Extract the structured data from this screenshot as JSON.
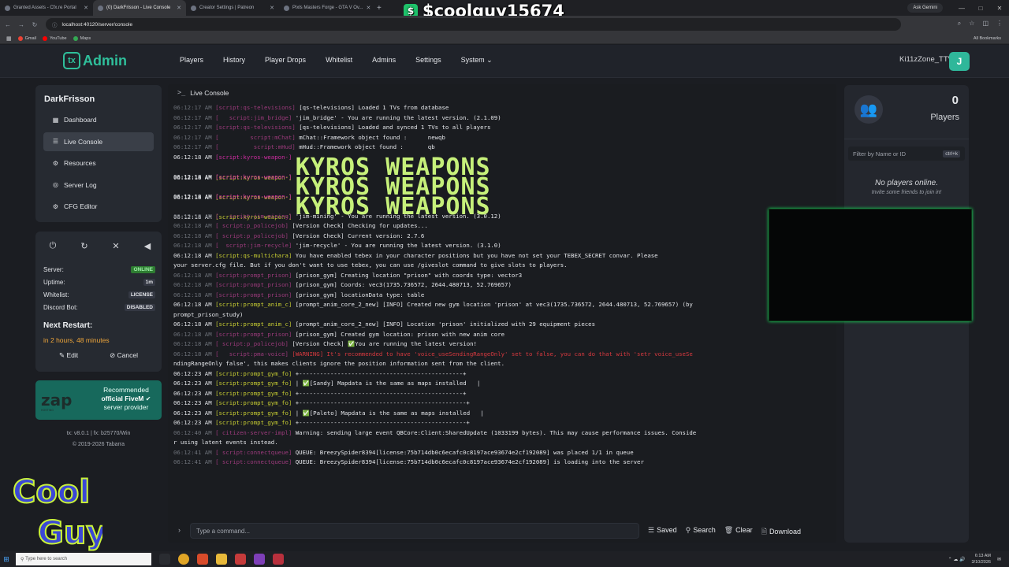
{
  "browser": {
    "tabs": [
      {
        "label": "Granted Assets - Cfx.re Portal",
        "active": false
      },
      {
        "label": "(0) DarkFrisson - Live Console",
        "active": true
      },
      {
        "label": "Creator Settings | Patreon",
        "active": false
      },
      {
        "label": "Pixls Masters Forge - GTA V Ov...",
        "active": false
      }
    ],
    "url": "localhost:40120/server/console",
    "gemini": "Ask Gemini",
    "bookmarks": [
      "Gmail",
      "YouTube",
      "Maps"
    ],
    "all_bookmarks": "All Bookmarks"
  },
  "overlay": {
    "username": "$coolguy15674",
    "coin": "$"
  },
  "app": {
    "logo_tx": "tx",
    "logo_name": "Admin",
    "nav": [
      "Players",
      "History",
      "Player Drops",
      "Whitelist",
      "Admins",
      "Settings",
      "System ⌄"
    ],
    "user_name": "Ki11zZone_TTV",
    "user_initial": "J"
  },
  "sidebar": {
    "server_name": "DarkFrisson",
    "items": [
      {
        "icon": "▦",
        "label": "Dashboard"
      },
      {
        "icon": "☰",
        "label": "Live Console"
      },
      {
        "icon": "⚙",
        "label": "Resources"
      },
      {
        "icon": "◎",
        "label": "Server Log"
      },
      {
        "icon": "⚙",
        "label": "CFG Editor"
      }
    ]
  },
  "status": {
    "controls": [
      "⏻",
      "↻",
      "✕",
      "◀"
    ],
    "server_label": "Server:",
    "server_value": "ONLINE",
    "uptime_label": "Uptime:",
    "uptime_value": "1m",
    "whitelist_label": "Whitelist:",
    "whitelist_value": "LICENSE",
    "discord_label": "Discord Bot:",
    "discord_value": "DISABLED",
    "restart_title": "Next Restart:",
    "restart_value": "in 2 hours, 48 minutes",
    "edit": "Edit",
    "cancel": "Cancel"
  },
  "promo": {
    "logo": "zap",
    "hosting": "HOSTING",
    "line1": "Recommended",
    "line2": "official FiveM",
    "line3": "server provider"
  },
  "version": {
    "line1": "tx: v8.0.1 | fx: b25770/Win",
    "line2": "© 2019-2026 Tabarra"
  },
  "console": {
    "title": "Live Console",
    "placeholder": "Type a command...",
    "actions": [
      "Saved",
      "Search",
      "Clear",
      "Download"
    ],
    "lines": [
      {
        "ts": "06:12:17 AM",
        "src": "[script:qs-televisions]",
        "msg": "[qs-televisions] Loaded 1 TVs from database"
      },
      {
        "ts": "06:12:17 AM",
        "src": "[   script:jim_bridge]",
        "msg": "'jim_bridge' - You are running the latest version. (2.1.09)"
      },
      {
        "ts": "06:12:17 AM",
        "src": "[script:qs-televisions]",
        "msg": "[qs-televisions] Loaded and synced 1 TVs to all players"
      },
      {
        "ts": "06:12:17 AM",
        "src": "[         script:mChat]",
        "msg": "mChat::Framework object found :      newqb"
      },
      {
        "ts": "06:12:17 AM",
        "src": "[          script:mHud]",
        "msg": "mHud::Framework object found :       qb"
      },
      {
        "ts": "06:12:18 AM",
        "src": "[script:kyros-weapon-]",
        "msg": "[INFO] kyros-weapon-pack-mafia-a is up to date! (1.0.0)"
      },
      {
        "ts": "06:12:18 AM",
        "src": "[script:kyros-weapon-]",
        "msg": "KYROS WEAPONS"
      },
      {
        "ts": "06:12:18 AM",
        "src": "[script:kyros-weapon-]",
        "msg": "[INFO] kyros-weapon-pack-mafia-b is up to date! (1.0.0)"
      },
      {
        "ts": "06:12:18 AM",
        "src": "[script:kyros-weapon-]",
        "msg": "KYROS WEAPONS"
      },
      {
        "ts": "06:12:18 AM",
        "src": "[script:kyros-weapon-]",
        "msg": "[INFO] kyros-weapon-pack-v3 is up to date! (3.1.2)"
      },
      {
        "ts": "06:12:18 AM",
        "src": "[script:kyros-weapon-]",
        "msg": "KYROS WEAPONS"
      },
      {
        "ts": "06:12:18 AM",
        "src": "[   script:jim-mining]",
        "msg": "'jim-mining' - You are running the latest version. (3.0.12)"
      },
      {
        "ts": "06:12:18 AM",
        "src": "[ script:p_policejob]",
        "msg": "[Version Check] Checking for updates..."
      },
      {
        "ts": "06:12:18 AM",
        "src": "[ script:p_policejob]",
        "msg": "[Version Check] Current version: 2.7.6"
      },
      {
        "ts": "06:12:18 AM",
        "src": "[  script:jim-recycle]",
        "msg": "'jim-recycle' - You are running the latest version. (3.1.0)"
      },
      {
        "ts": "06:12:18 AM",
        "src": "[script:qs-multichara]",
        "msg": "You have enabled tebex in your character positions but you have not set your TEBEX_SECRET convar. Please"
      },
      {
        "ts": "",
        "src": "",
        "msg": "your server.cfg file. But if you don't want to use tebex, you can use /giveslot command to give slots to players."
      },
      {
        "ts": "06:12:18 AM",
        "src": "[script:prompt_prison]",
        "msg": "[prison_gym] Creating location \"prison\" with coords type: vector3"
      },
      {
        "ts": "06:12:18 AM",
        "src": "[script:prompt_prison]",
        "msg": "[prison_gym] Coords: vec3(1735.736572, 2644.480713, 52.769657)"
      },
      {
        "ts": "06:12:18 AM",
        "src": "[script:prompt_prison]",
        "msg": "[prison_gym] locationData type: table"
      },
      {
        "ts": "06:12:18 AM",
        "src": "[script:prompt_anim_c]",
        "msg": "[prompt_anim_core_2_new] [INFO] Created new gym location 'prison' at vec3(1735.736572, 2644.480713, 52.769657) (by"
      },
      {
        "ts": "",
        "src": "",
        "msg": "prompt_prison_study)"
      },
      {
        "ts": "06:12:18 AM",
        "src": "[script:prompt_anim_c]",
        "msg": "[prompt_anim_core_2_new] [INFO] Location 'prison' initialized with 29 equipment pieces"
      },
      {
        "ts": "06:12:18 AM",
        "src": "[script:prompt_prison]",
        "msg": "[prison_gym] Created gym location: prison with new anim core"
      },
      {
        "ts": "06:12:18 AM",
        "src": "[ script:p_policejob]",
        "msg": "[Version Check] ✅You are running the latest version!"
      },
      {
        "ts": "06:12:18 AM",
        "src": "[   script:pma-voice]",
        "msg": "[WARNING] It's recommended to have 'voice_useSendingRangeOnly' set to false, you can do that with 'setr voice_useSe"
      },
      {
        "ts": "",
        "src": "",
        "msg": "ndingRangeOnly false', this makes clients ignore the position information sent from the client."
      },
      {
        "ts": "06:12:23 AM",
        "src": "[script:prompt_gym_fo]",
        "msg": "+-----------------------------------------------+"
      },
      {
        "ts": "06:12:23 AM",
        "src": "[script:prompt_gym_fo]",
        "msg": "| ✅[Sandy] Mapdata is the same as maps installed   |"
      },
      {
        "ts": "06:12:23 AM",
        "src": "[script:prompt_gym_fo]",
        "msg": "+-----------------------------------------------+"
      },
      {
        "ts": "06:12:23 AM",
        "src": "[script:prompt_gym_fo]",
        "msg": "+------------------------------------------------+"
      },
      {
        "ts": "06:12:23 AM",
        "src": "[script:prompt_gym_fo]",
        "msg": "| ✅[Paleto] Mapdata is the same as maps installed   |"
      },
      {
        "ts": "06:12:23 AM",
        "src": "[script:prompt_gym_fo]",
        "msg": "+------------------------------------------------+"
      },
      {
        "ts": "06:12:40 AM",
        "src": "[ citizen-server-impl]",
        "msg": "Warning: sending large event QBCore:Client:SharedUpdate (1033199 bytes). This may cause performance issues. Conside"
      },
      {
        "ts": "",
        "src": "",
        "msg": "r using latent events instead."
      },
      {
        "ts": "06:12:41 AM",
        "src": "[ script:connectqueue]",
        "msg": "QUEUE: BreezySpider8394[license:75b714db0c6ecafc0c8197ace93674e2cf192089] was placed 1/1 in queue"
      },
      {
        "ts": "06:12:41 AM",
        "src": "[ script:connectqueue]",
        "msg": "QUEUE: BreezySpider8394[license:75b714db0c6ecafc0c8197ace93674e2cf192089] is loading into the server"
      }
    ]
  },
  "players": {
    "count": "0",
    "label": "Players",
    "filter_placeholder": "Filter by Name or ID",
    "filter_kbd": "ctrl+k",
    "none": "No players online.",
    "invite": "Invite some friends to join in!"
  },
  "taskbar": {
    "search_placeholder": "Type here to search",
    "time": "6:13 AM",
    "date": "3/10/2026"
  },
  "stream_logo": {
    "line1": "Cool",
    "line2": "Guy!"
  }
}
